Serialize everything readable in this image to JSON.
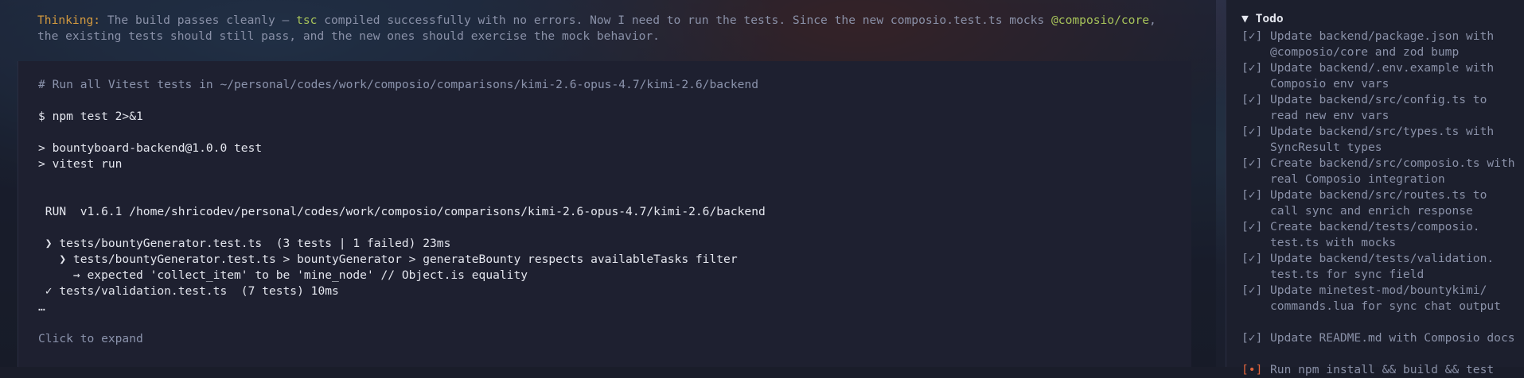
{
  "thinking": {
    "label": "Thinking:",
    "line1_a": " The build passes cleanly — ",
    "line1_tsc": "tsc",
    "line1_b": " compiled successfully with no errors. Now I need to run the tests. Since the new composio.test.ts mocks ",
    "line1_pkg": "@composio/core",
    "line1_c": ",",
    "line2": "the existing tests should still pass, and the new ones should exercise the mock behavior."
  },
  "terminal": {
    "comment": "# Run all Vitest tests in ~/personal/codes/work/composio/comparisons/kimi-2.6-opus-4.7/kimi-2.6/backend",
    "command": "$ npm test 2>&1",
    "script1": "> bountyboard-backend@1.0.0 test",
    "script2": "> vitest run",
    "run_line": " RUN  v1.6.1 /home/shricodev/personal/codes/work/composio/comparisons/kimi-2.6-opus-4.7/kimi-2.6/backend",
    "fail_file": " ❯ tests/bountyGenerator.test.ts  (3 tests | 1 failed) 23ms",
    "fail_test": "   ❯ tests/bountyGenerator.test.ts > bountyGenerator > generateBounty respects availableTasks filter",
    "fail_reason": "     → expected 'collect_item' to be 'mine_node' // Object.is equality",
    "pass_file": " ✓ tests/validation.test.ts  (7 tests) 10ms",
    "ellipsis": "…",
    "expand": "Click to expand"
  },
  "todo": {
    "title": "▼ Todo",
    "items": [
      {
        "check": "[✓]",
        "text": "Update backend/package.json with @composio/core and zod bump"
      },
      {
        "check": "[✓]",
        "text": "Update backend/.env.example with Composio env vars"
      },
      {
        "check": "[✓]",
        "text": "Update backend/src/config.ts to read new env vars"
      },
      {
        "check": "[✓]",
        "text": "Update backend/src/types.ts with SyncResult types"
      },
      {
        "check": "[✓]",
        "text": "Create backend/src/composio.ts with real Composio integration"
      },
      {
        "check": "[✓]",
        "text": "Update backend/src/routes.ts to call sync and enrich response"
      },
      {
        "check": "[✓]",
        "text": "Create backend/tests/composio.\ntest.ts with mocks"
      },
      {
        "check": "[✓]",
        "text": "Update backend/tests/validation.\ntest.ts for sync field"
      },
      {
        "check": "[✓]",
        "text": "Update minetest-mod/bountykimi/\ncommands.lua for sync chat output"
      },
      {
        "check": "[✓]",
        "text": "Update README.md with Composio docs"
      },
      {
        "check": "[•]",
        "text": "Run npm install && build && test"
      }
    ]
  }
}
